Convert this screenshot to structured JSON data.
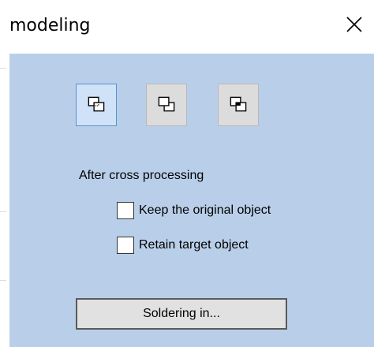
{
  "window": {
    "title": "modeling",
    "close_icon": "close-icon"
  },
  "modes": [
    {
      "name": "cross-union-mode",
      "icon": "overlap-dotted-icon",
      "active": true
    },
    {
      "name": "cross-subtract-mode",
      "icon": "overlap-front-icon",
      "active": false
    },
    {
      "name": "cross-intersect-mode",
      "icon": "overlap-filled-icon",
      "active": false
    }
  ],
  "section": {
    "label": "After cross processing"
  },
  "options": {
    "keep_original": {
      "label": "Keep the original object",
      "checked": false
    },
    "retain_target": {
      "label": "Retain target object",
      "checked": false
    }
  },
  "actions": {
    "solder_label": "Soldering in..."
  },
  "colors": {
    "client_bg": "#b9cfe9",
    "active_button_bg": "#cfe2f7",
    "active_button_border": "#5b8fd1",
    "button_bg": "#dcdcdc"
  }
}
